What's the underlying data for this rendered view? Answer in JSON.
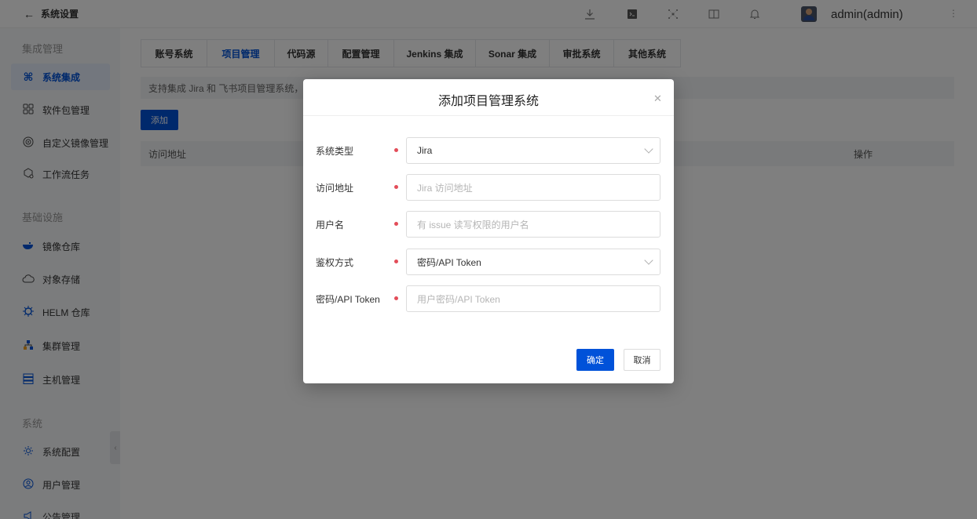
{
  "topbar": {
    "back_label": "系统设置",
    "username": "admin(admin)",
    "icons": [
      "download-icon",
      "terminal-icon",
      "network-icon",
      "book-icon",
      "bell-icon",
      "avatar",
      "more-icon"
    ]
  },
  "sidebar": {
    "sections": [
      {
        "title": "集成管理",
        "items": [
          {
            "label": "系统集成",
            "icon": "integration-icon",
            "active": true
          },
          {
            "label": "软件包管理",
            "icon": "grid-icon"
          },
          {
            "label": "自定义镜像管理",
            "icon": "image-icon"
          },
          {
            "label": "工作流任务",
            "icon": "workflow-icon"
          }
        ]
      },
      {
        "title": "基础设施",
        "items": [
          {
            "label": "镜像仓库",
            "icon": "whale-icon"
          },
          {
            "label": "对象存储",
            "icon": "cloud-icon"
          },
          {
            "label": "HELM 仓库",
            "icon": "helm-icon"
          },
          {
            "label": "集群管理",
            "icon": "cluster-icon"
          },
          {
            "label": "主机管理",
            "icon": "server-icon"
          }
        ]
      },
      {
        "title": "系统",
        "items": [
          {
            "label": "系统配置",
            "icon": "settings-icon"
          },
          {
            "label": "用户管理",
            "icon": "user-icon"
          },
          {
            "label": "公告管理",
            "icon": "announcement-icon"
          }
        ]
      }
    ]
  },
  "main": {
    "tabs": [
      {
        "label": "账号系统"
      },
      {
        "label": "项目管理",
        "active": true
      },
      {
        "label": "代码源"
      },
      {
        "label": "配置管理"
      },
      {
        "label": "Jenkins 集成"
      },
      {
        "label": "Sonar 集成"
      },
      {
        "label": "审批系统"
      },
      {
        "label": "其他系统"
      }
    ],
    "info_text": "支持集成 Jira 和 飞书项目管理系统，",
    "add_label": "添加",
    "table_headers": {
      "address": "访问地址",
      "actions": "操作"
    }
  },
  "modal": {
    "title": "添加项目管理系统",
    "close_icon": "close-icon",
    "fields": [
      {
        "label": "系统类型",
        "value": "Jira",
        "type": "select"
      },
      {
        "label": "访问地址",
        "placeholder": "Jira 访问地址",
        "type": "input"
      },
      {
        "label": "用户名",
        "placeholder": "有 issue 读写权限的用户名",
        "type": "input"
      },
      {
        "label": "鉴权方式",
        "value": "密码/API Token",
        "type": "select"
      },
      {
        "label": "密码/API Token",
        "placeholder": "用户密码/API Token",
        "type": "input"
      }
    ],
    "ok_label": "确定",
    "cancel_label": "取消"
  },
  "colors": {
    "primary": "#0052d9",
    "required": "#e34d59",
    "sidebar_bg": "#f7f8fa",
    "overlay": "rgba(0,0,0,0.5)"
  }
}
